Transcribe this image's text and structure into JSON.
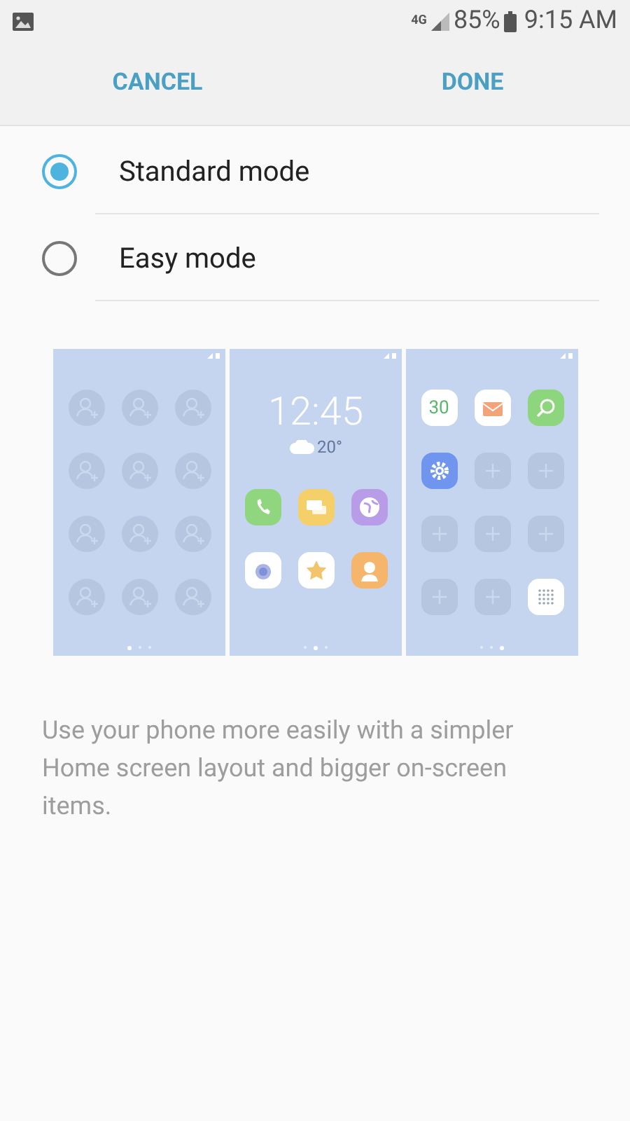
{
  "status_bar": {
    "network": "4G",
    "battery": "85%",
    "time": "9:15 AM"
  },
  "header": {
    "cancel": "CANCEL",
    "done": "DONE"
  },
  "modes": [
    {
      "label": "Standard mode",
      "selected": true
    },
    {
      "label": "Easy mode",
      "selected": false
    }
  ],
  "previews": [
    {
      "kind": "contacts",
      "dots": [
        {
          "selected": true
        },
        {
          "selected": false
        },
        {
          "selected": false
        }
      ]
    },
    {
      "kind": "clock",
      "time": "12:45",
      "temperature": "20°",
      "dots": [
        {
          "selected": false
        },
        {
          "selected": true
        },
        {
          "selected": false
        }
      ]
    },
    {
      "kind": "apps",
      "calendar_day": "30",
      "dots": [
        {
          "selected": false
        },
        {
          "selected": false
        },
        {
          "selected": true
        }
      ]
    }
  ],
  "description": "Use your phone more easily with a simpler Home screen layout and bigger on-screen items."
}
